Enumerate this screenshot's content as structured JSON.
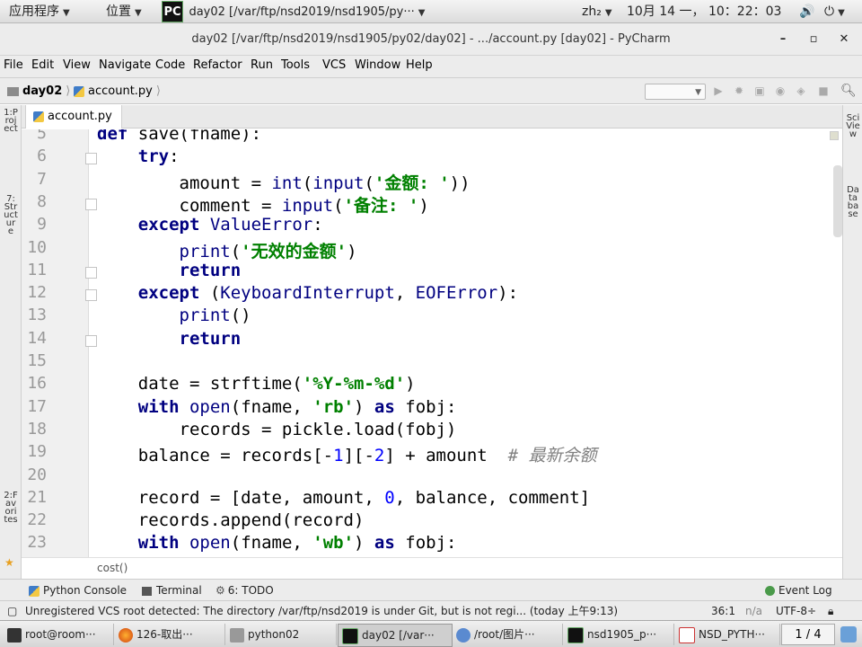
{
  "topbar": {
    "apps": "应用程序",
    "places": "位置",
    "window_title": "day02 [/var/ftp/nsd2019/nsd1905/py···",
    "input_method": "zh₂",
    "clock": "10月 14 一， 10：22：03"
  },
  "window": {
    "title": "day02 [/var/ftp/nsd2019/nsd1905/py02/day02] - .../account.py [day02] - PyCharm",
    "minimize": "–",
    "maximize": "▫",
    "close": "✕"
  },
  "menubar": [
    "File",
    "Edit",
    "View",
    "Navigate",
    "Code",
    "Refactor",
    "Run",
    "Tools",
    "VCS",
    "Window",
    "Help"
  ],
  "navbar": {
    "project": "day02",
    "file": "account.py"
  },
  "leftstrip": {
    "top": "1:Project",
    "bottom": "2:Favorites",
    "structure": "7:Structure"
  },
  "rightstrip": {
    "top": "SciView",
    "bottom": "Database"
  },
  "tab": {
    "label": "account.py"
  },
  "editor": {
    "lines": [
      {
        "n": "5",
        "code": "def save(fname):"
      },
      {
        "n": "6",
        "code": "    try:"
      },
      {
        "n": "7",
        "code": "        amount = int(input('金额: '))"
      },
      {
        "n": "8",
        "code": "        comment = input('备注: ')"
      },
      {
        "n": "9",
        "code": "    except ValueError:"
      },
      {
        "n": "10",
        "code": "        print('无效的金额')"
      },
      {
        "n": "11",
        "code": "        return"
      },
      {
        "n": "12",
        "code": "    except (KeyboardInterrupt, EOFError):"
      },
      {
        "n": "13",
        "code": "        print()"
      },
      {
        "n": "14",
        "code": "        return"
      },
      {
        "n": "15",
        "code": ""
      },
      {
        "n": "16",
        "code": "    date = strftime('%Y-%m-%d')"
      },
      {
        "n": "17",
        "code": "    with open(fname, 'rb') as fobj:"
      },
      {
        "n": "18",
        "code": "        records = pickle.load(fobj)"
      },
      {
        "n": "19",
        "code": "    balance = records[-1][-2] + amount  # 最新余额"
      },
      {
        "n": "20",
        "code": ""
      },
      {
        "n": "21",
        "code": "    record = [date, amount, 0, balance, comment]"
      },
      {
        "n": "22",
        "code": "    records.append(record)"
      },
      {
        "n": "23",
        "code": "    with open(fname, 'wb') as fobj:"
      }
    ],
    "breadcrumb": "cost()"
  },
  "toolwindows": {
    "python_console": "Python Console",
    "terminal": "Terminal",
    "todo": "6: TODO",
    "event_log": "Event Log"
  },
  "status": {
    "message": "Unregistered VCS root detected: The directory /var/ftp/nsd2019 is under Git, but is not regi... (today 上午9:13)",
    "position": "36:1",
    "na": "n/a",
    "encoding": "UTF-8÷"
  },
  "taskbar": {
    "items": [
      "root@room···",
      "126-取出···",
      "python02",
      "day02 [/var···",
      "/root/图片···",
      "nsd1905_p···",
      "NSD_PYTH···"
    ],
    "pager": "1 / 4"
  },
  "colors": {
    "keyword": "#000080",
    "string": "#008000",
    "number": "#0000ff",
    "comment": "#808080"
  }
}
